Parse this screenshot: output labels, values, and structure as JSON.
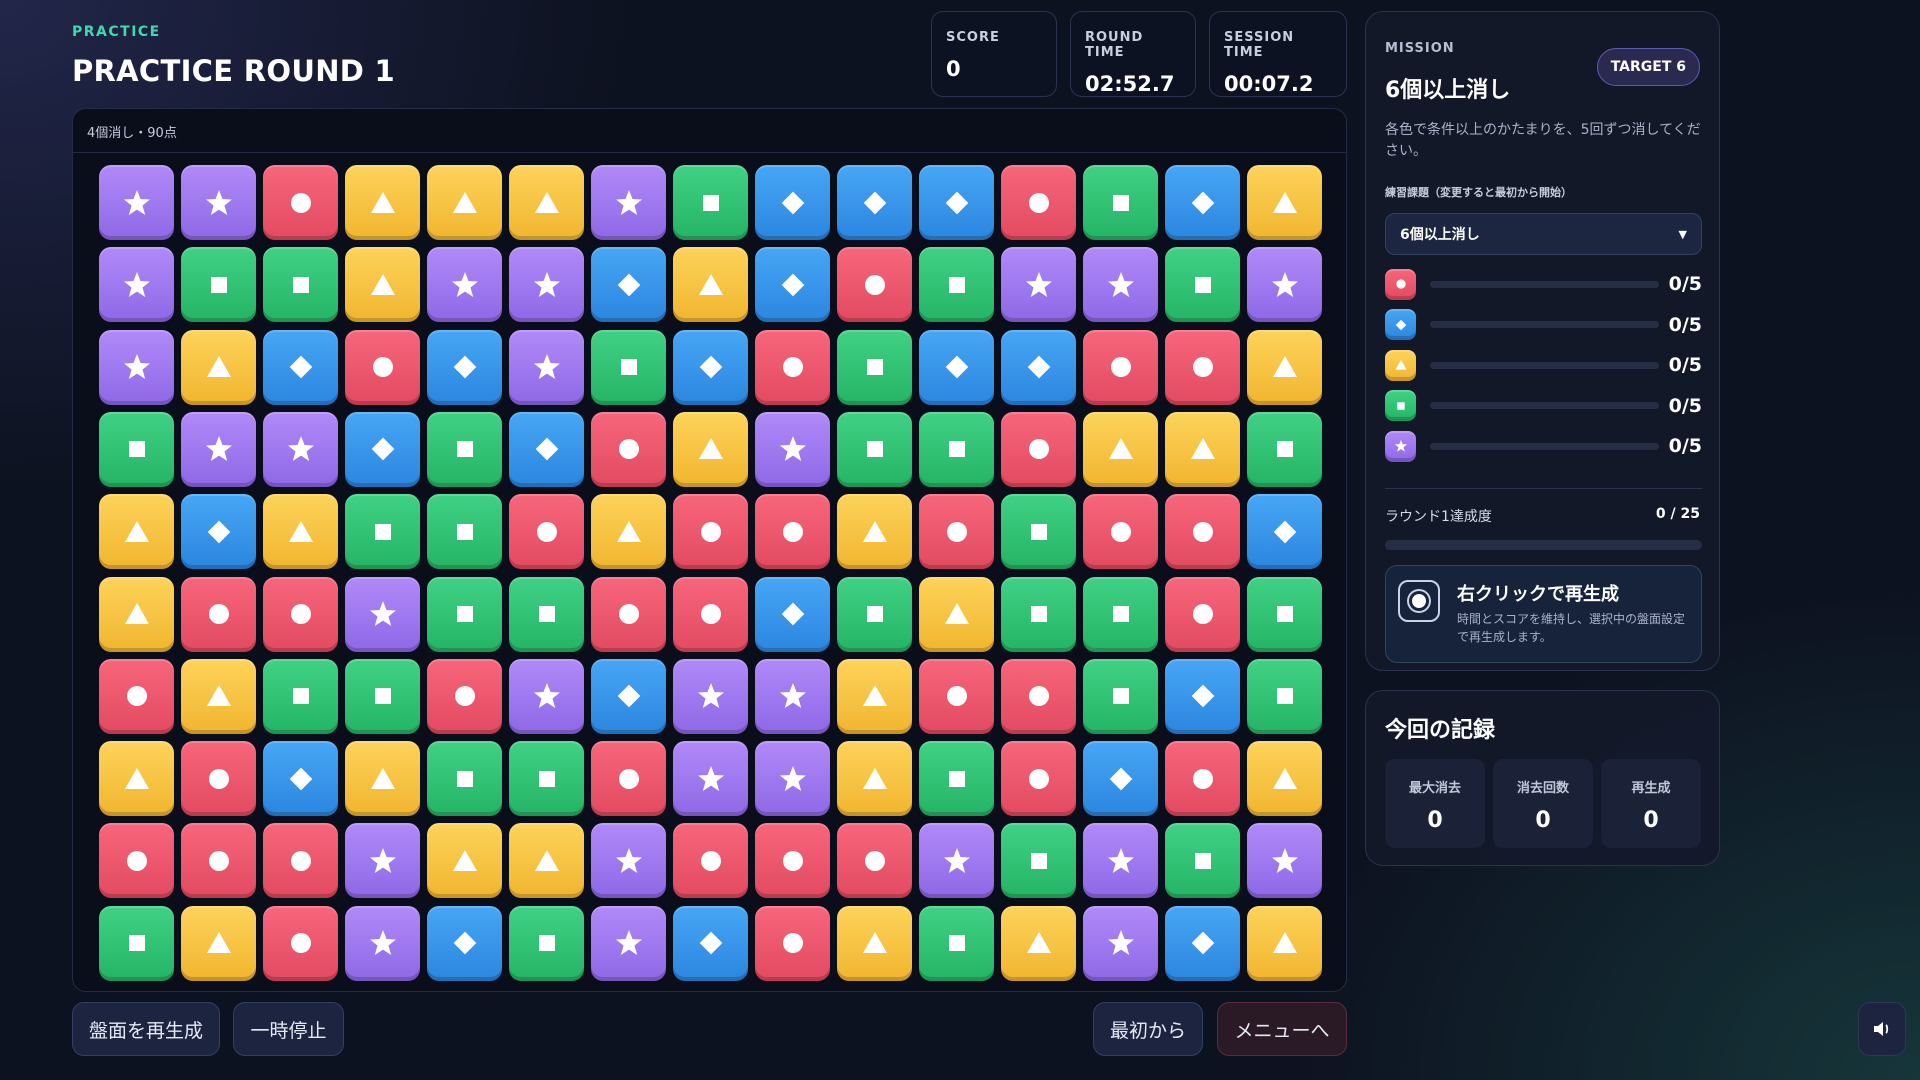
{
  "header": {
    "eyebrow": "PRACTICE",
    "title": "PRACTICE ROUND 1"
  },
  "stats": {
    "score_label": "SCORE",
    "score": "0",
    "round_time_label": "ROUND TIME",
    "round_time": "02:52.7",
    "session_time_label": "SESSION TIME",
    "session_time": "00:07.2"
  },
  "board": {
    "header_text": "4個消し・90点",
    "colors": {
      "red": "#e9536a",
      "blue": "#3897ea",
      "yellow": "#f7c442",
      "green": "#30c274",
      "purple": "#9d78ef"
    },
    "shapes": {
      "red": "circle",
      "blue": "diamond",
      "yellow": "triangle",
      "green": "square",
      "purple": "star"
    },
    "rows": [
      [
        "purple",
        "purple",
        "red",
        "yellow",
        "yellow",
        "yellow",
        "purple",
        "green",
        "blue",
        "blue",
        "blue",
        "red",
        "green",
        "blue",
        "yellow"
      ],
      [
        "purple",
        "green",
        "green",
        "yellow",
        "purple",
        "purple",
        "blue",
        "yellow",
        "blue",
        "red",
        "green",
        "purple",
        "purple",
        "green",
        "purple"
      ],
      [
        "purple",
        "yellow",
        "blue",
        "red",
        "blue",
        "purple",
        "green",
        "blue",
        "red",
        "green",
        "blue",
        "blue",
        "red",
        "red",
        "yellow"
      ],
      [
        "green",
        "purple",
        "purple",
        "blue",
        "green",
        "blue",
        "red",
        "yellow",
        "purple",
        "green",
        "green",
        "red",
        "yellow",
        "yellow",
        "green"
      ],
      [
        "yellow",
        "blue",
        "yellow",
        "green",
        "green",
        "red",
        "yellow",
        "red",
        "red",
        "yellow",
        "red",
        "green",
        "red",
        "red",
        "blue"
      ],
      [
        "yellow",
        "red",
        "red",
        "purple",
        "green",
        "green",
        "red",
        "red",
        "blue",
        "green",
        "yellow",
        "green",
        "green",
        "red",
        "green"
      ],
      [
        "red",
        "yellow",
        "green",
        "green",
        "red",
        "purple",
        "blue",
        "purple",
        "purple",
        "yellow",
        "red",
        "red",
        "green",
        "blue",
        "green"
      ],
      [
        "yellow",
        "red",
        "blue",
        "yellow",
        "green",
        "green",
        "red",
        "purple",
        "purple",
        "yellow",
        "green",
        "red",
        "blue",
        "red",
        "yellow"
      ],
      [
        "red",
        "red",
        "red",
        "purple",
        "yellow",
        "yellow",
        "purple",
        "red",
        "red",
        "red",
        "purple",
        "green",
        "purple",
        "green",
        "purple"
      ],
      [
        "green",
        "yellow",
        "red",
        "purple",
        "blue",
        "green",
        "purple",
        "blue",
        "red",
        "yellow",
        "green",
        "yellow",
        "purple",
        "blue",
        "yellow"
      ]
    ]
  },
  "buttons": {
    "regenerate": "盤面を再生成",
    "pause": "一時停止",
    "restart": "最初から",
    "menu": "メニューへ"
  },
  "mission": {
    "label": "MISSION",
    "title": "6個以上消し",
    "target": "TARGET 6",
    "description": "各色で条件以上のかたまりを、5回ずつ消してください。",
    "select_label": "練習課題（変更すると最初から開始）",
    "select_value": "6個以上消し",
    "progress": [
      {
        "color": "red",
        "icon": "circle-icon",
        "value": "0/5",
        "fraction": 0
      },
      {
        "color": "blue",
        "icon": "diamond-icon",
        "value": "0/5",
        "fraction": 0
      },
      {
        "color": "yellow",
        "icon": "triangle-icon",
        "value": "0/5",
        "fraction": 0
      },
      {
        "color": "green",
        "icon": "square-icon",
        "value": "0/5",
        "fraction": 0
      },
      {
        "color": "purple",
        "icon": "star-icon",
        "value": "0/5",
        "fraction": 0
      }
    ],
    "achievement_label": "ラウンド1達成度",
    "achievement_value": "0 / 25",
    "achievement_fraction": 0,
    "hint_title": "右クリックで再生成",
    "hint_text": "時間とスコアを維持し、選択中の盤面設定で再生成します。"
  },
  "record": {
    "title": "今回の記録",
    "items": [
      {
        "label": "最大消去",
        "value": "0"
      },
      {
        "label": "消去回数",
        "value": "0"
      },
      {
        "label": "再生成",
        "value": "0"
      }
    ]
  },
  "sound_icon": "speaker-icon"
}
